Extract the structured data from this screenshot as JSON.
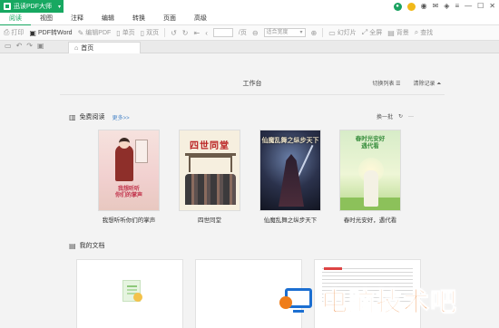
{
  "app": {
    "name": "迅读PDF大师",
    "caret": "▾"
  },
  "menu": [
    "阅读",
    "视图",
    "注释",
    "编辑",
    "转换",
    "页面",
    "高级"
  ],
  "window_controls": {
    "user_icon": "user-icon",
    "coin_icon": "coin-icon",
    "ok_icon": "ok-icon",
    "mail_icon": "mail-icon",
    "skin_icon": "skin-icon",
    "menu_icon": "menu-icon",
    "minimize": "—",
    "maximize": "☐",
    "close": "✕"
  },
  "toolbar": {
    "print": "打印",
    "pdf_to_word": "PDF转Word",
    "edit_pdf": "编辑PDF",
    "single_page": "单页",
    "double_page": "双页",
    "page_total": "/页",
    "zoom": "适合宽度",
    "slideshow": "幻灯片",
    "fullscreen": "全屏",
    "background": "背景",
    "search": "查找"
  },
  "tabs": {
    "home": "首页"
  },
  "workspace": {
    "title": "工作台",
    "switch_list": "切换列表 ☰",
    "clear_history": "清除记录 ⏶"
  },
  "free_reading": {
    "title": "免费阅读",
    "more": "更多>>",
    "refresh": "换一批",
    "ellipsis": "···",
    "books": [
      {
        "title": "我想听听你们的掌声",
        "cover_text": "我想听听\n你们的掌声"
      },
      {
        "title": "四世同堂",
        "cover_text": "四世同堂"
      },
      {
        "title": "仙魔乱舞之纵步天下",
        "cover_text": "仙魔乱舞之纵步天下"
      },
      {
        "title": "春时光安好，遇代看",
        "cover_text": "春时光安好\n遇代看"
      }
    ]
  },
  "my_docs": {
    "title": "我的文档"
  },
  "watermark": {
    "text": "电脑技术吧"
  },
  "colors": {
    "brand_green": "#17a861",
    "link_blue": "#4a86c8",
    "watermark_orange": "#e8731c",
    "watermark_blue": "#1c6fd1"
  }
}
